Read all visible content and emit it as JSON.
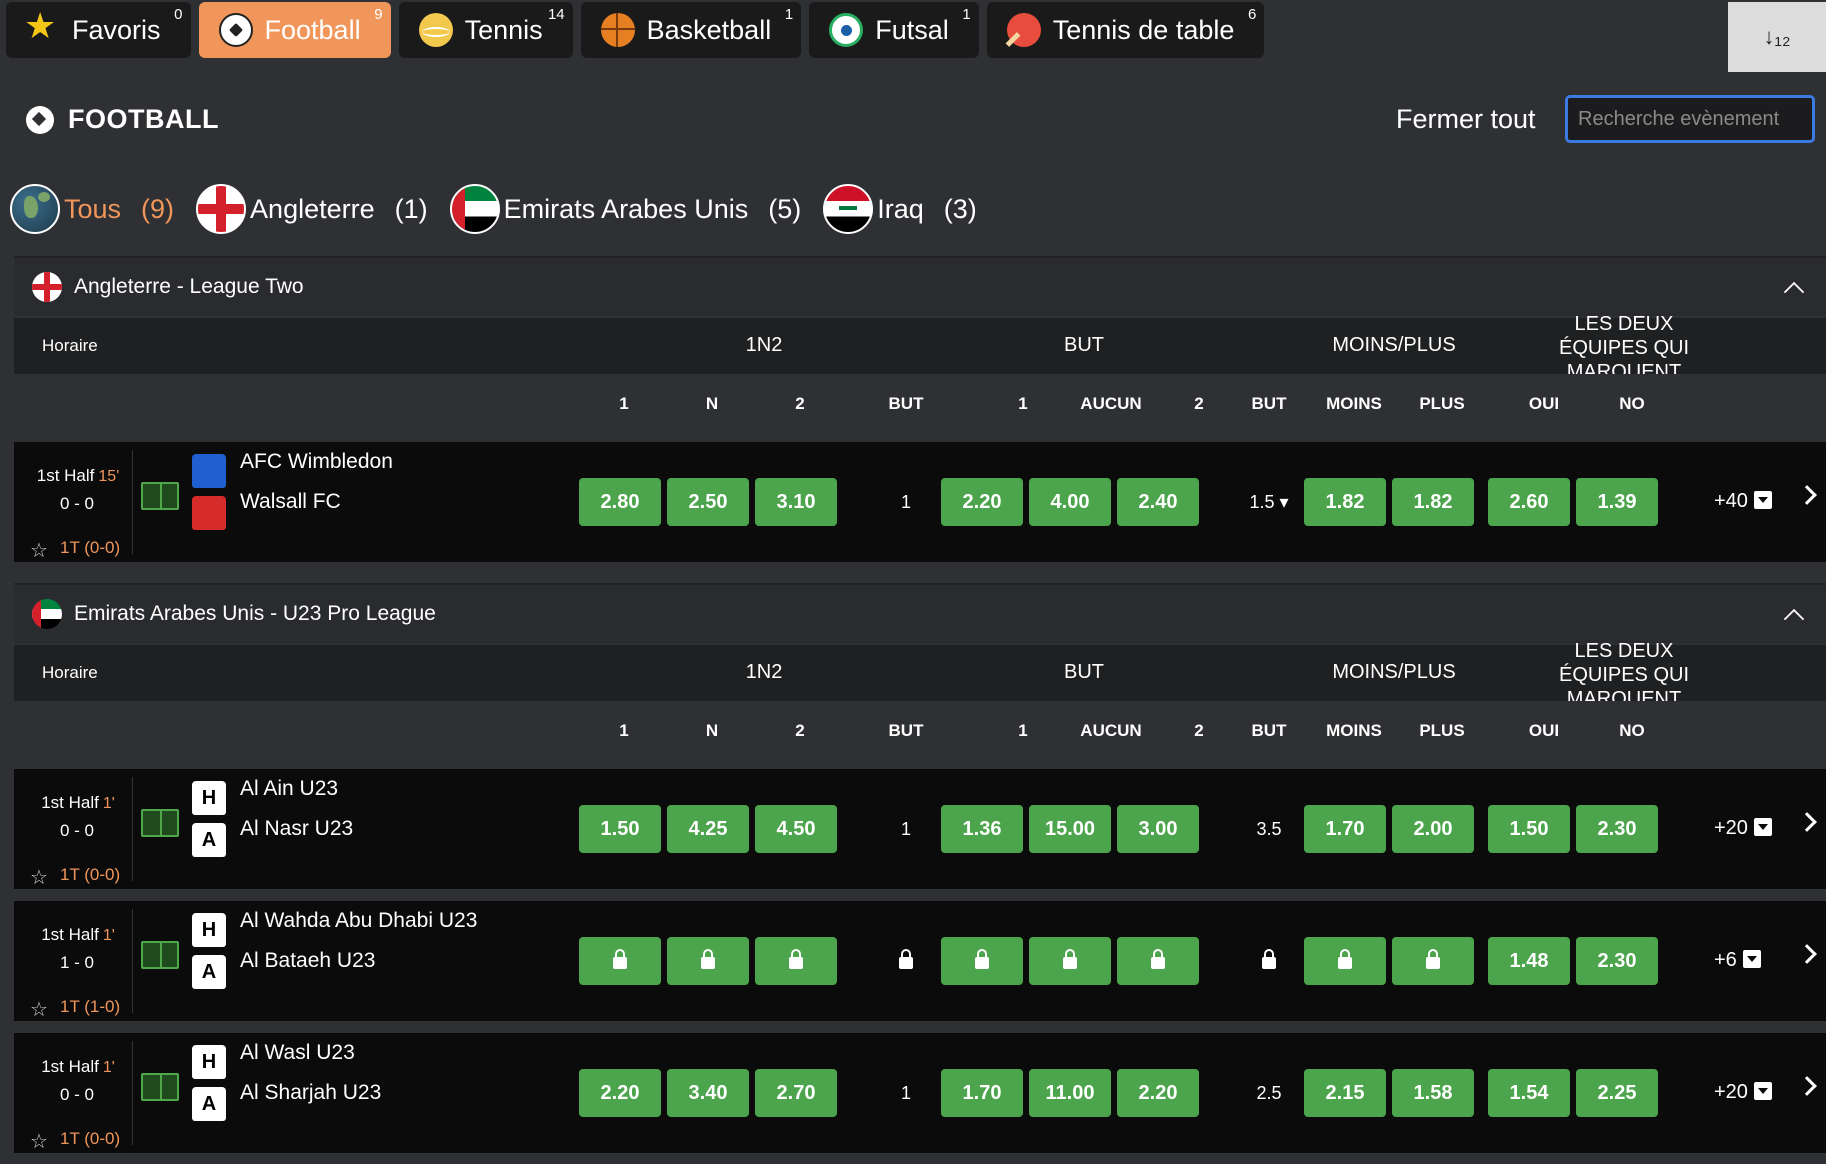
{
  "tabs": [
    {
      "label": "Favoris",
      "count": "0",
      "icon": "star-icon"
    },
    {
      "label": "Football",
      "count": "9",
      "icon": "football-icon"
    },
    {
      "label": "Tennis",
      "count": "14",
      "icon": "tennis-ball-icon"
    },
    {
      "label": "Basketball",
      "count": "1",
      "icon": "basketball-icon"
    },
    {
      "label": "Futsal",
      "count": "1",
      "icon": "futsal-ball-icon"
    },
    {
      "label": "Tennis de table",
      "count": "6",
      "icon": "ping-pong-icon"
    }
  ],
  "sort_icon": "↓₁₂",
  "section_title": "FOOTBALL",
  "close_all": "Fermer tout",
  "search_placeholder": "Recherche evènement",
  "countries": [
    {
      "label": "Tous",
      "count": "(9)"
    },
    {
      "label": "Angleterre",
      "count": "(1)"
    },
    {
      "label": "Emirats Arabes Unis",
      "count": "(5)"
    },
    {
      "label": "Iraq",
      "count": "(3)"
    }
  ],
  "headers": {
    "horaire": "Horaire",
    "g_1n2": "1N2",
    "g_but": "BUT",
    "g_moinsplus": "MOINS/PLUS",
    "g_deux": "LES DEUX ÉQUIPES QUI MARQUENT",
    "sub": [
      "1",
      "N",
      "2",
      "BUT",
      "1",
      "AUCUN",
      "2",
      "BUT",
      "MOINS",
      "PLUS",
      "OUI",
      "NO"
    ]
  },
  "leagues": [
    {
      "name": "Angleterre - League Two",
      "matches": [
        {
          "status": "1st Half",
          "minute": "15'",
          "score": "0 - 0",
          "ht": "1T (0-0)",
          "home": "AFC Wimbledon",
          "away": "Walsall FC",
          "odds_1n2": [
            "2.80",
            "2.50",
            "3.10"
          ],
          "but_line": "1",
          "odds_but": [
            "2.20",
            "4.00",
            "2.40"
          ],
          "mp_line": "1.5 ▾",
          "odds_mp": [
            "1.82",
            "1.82"
          ],
          "odds_bts": [
            "2.60",
            "1.39"
          ],
          "more": "+40"
        }
      ]
    },
    {
      "name": "Emirats Arabes Unis - U23 Pro League",
      "matches": [
        {
          "status": "1st Half",
          "minute": "1'",
          "score": "0 - 0",
          "ht": "1T (0-0)",
          "home": "Al Ain U23",
          "away": "Al Nasr U23",
          "odds_1n2": [
            "1.50",
            "4.25",
            "4.50"
          ],
          "but_line": "1",
          "odds_but": [
            "1.36",
            "15.00",
            "3.00"
          ],
          "mp_line": "3.5",
          "odds_mp": [
            "1.70",
            "2.00"
          ],
          "odds_bts": [
            "1.50",
            "2.30"
          ],
          "more": "+20"
        },
        {
          "status": "1st Half",
          "minute": "1'",
          "score": "1 - 0",
          "ht": "1T (1-0)",
          "home": "Al Wahda Abu Dhabi U23",
          "away": "Al Bataeh U23",
          "odds_1n2": [
            "",
            "",
            ""
          ],
          "but_line": "",
          "odds_but": [
            "",
            "",
            ""
          ],
          "mp_line": "",
          "odds_mp": [
            "",
            ""
          ],
          "odds_bts": [
            "1.48",
            "2.30"
          ],
          "more": "+6"
        },
        {
          "status": "1st Half",
          "minute": "1'",
          "score": "0 - 0",
          "ht": "1T (0-0)",
          "home": "Al Wasl U23",
          "away": "Al Sharjah U23",
          "odds_1n2": [
            "2.20",
            "3.40",
            "2.70"
          ],
          "but_line": "1",
          "odds_but": [
            "1.70",
            "11.00",
            "2.20"
          ],
          "mp_line": "2.5",
          "odds_mp": [
            "2.15",
            "1.58"
          ],
          "odds_bts": [
            "1.54",
            "2.25"
          ],
          "more": "+20"
        }
      ]
    }
  ],
  "colors": {
    "accent": "#f0965a",
    "odd_green": "#4ca54c",
    "search_border": "#3b7ae0"
  }
}
